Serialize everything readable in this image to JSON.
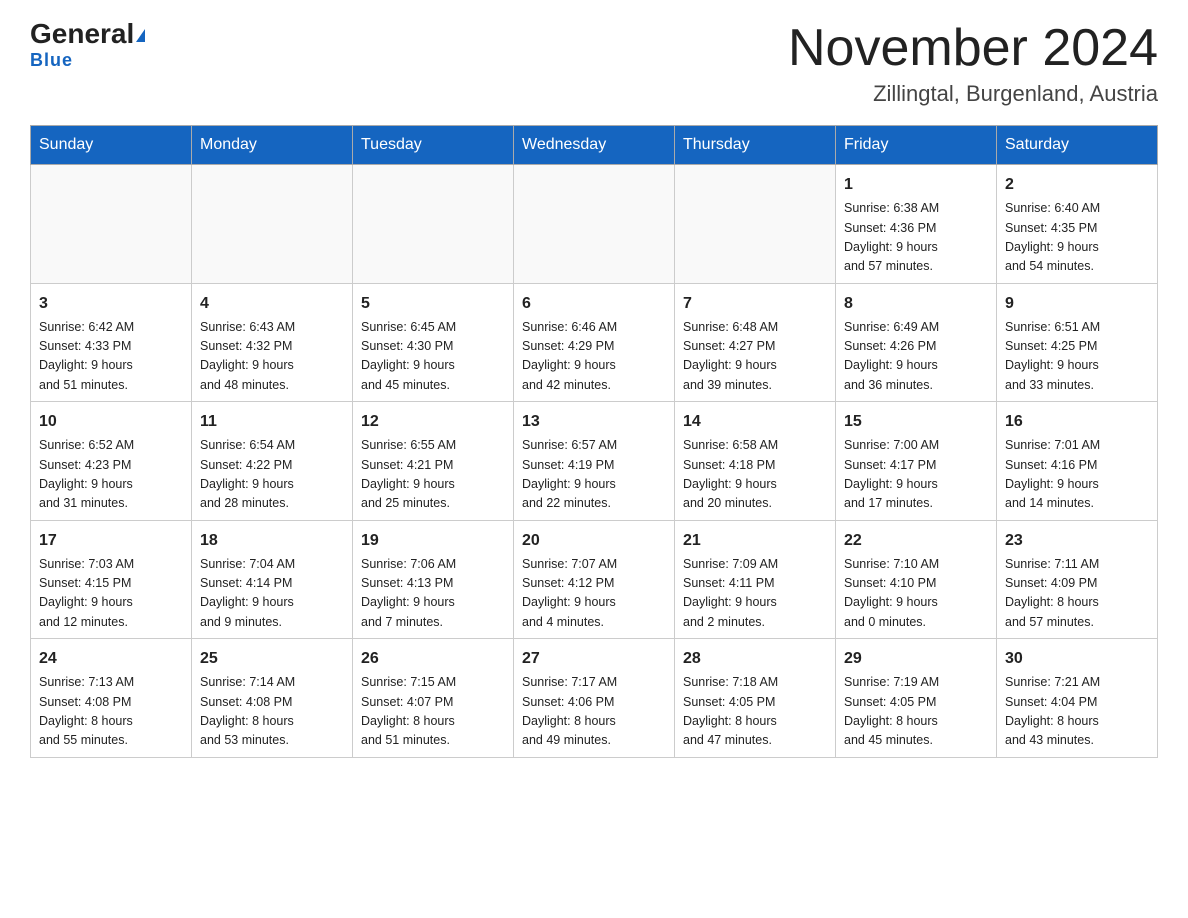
{
  "header": {
    "logo_text_black": "General",
    "logo_text_blue": "Blue",
    "month_title": "November 2024",
    "location": "Zillingtal, Burgenland, Austria"
  },
  "weekdays": [
    "Sunday",
    "Monday",
    "Tuesday",
    "Wednesday",
    "Thursday",
    "Friday",
    "Saturday"
  ],
  "weeks": [
    [
      {
        "day": "",
        "info": ""
      },
      {
        "day": "",
        "info": ""
      },
      {
        "day": "",
        "info": ""
      },
      {
        "day": "",
        "info": ""
      },
      {
        "day": "",
        "info": ""
      },
      {
        "day": "1",
        "info": "Sunrise: 6:38 AM\nSunset: 4:36 PM\nDaylight: 9 hours\nand 57 minutes."
      },
      {
        "day": "2",
        "info": "Sunrise: 6:40 AM\nSunset: 4:35 PM\nDaylight: 9 hours\nand 54 minutes."
      }
    ],
    [
      {
        "day": "3",
        "info": "Sunrise: 6:42 AM\nSunset: 4:33 PM\nDaylight: 9 hours\nand 51 minutes."
      },
      {
        "day": "4",
        "info": "Sunrise: 6:43 AM\nSunset: 4:32 PM\nDaylight: 9 hours\nand 48 minutes."
      },
      {
        "day": "5",
        "info": "Sunrise: 6:45 AM\nSunset: 4:30 PM\nDaylight: 9 hours\nand 45 minutes."
      },
      {
        "day": "6",
        "info": "Sunrise: 6:46 AM\nSunset: 4:29 PM\nDaylight: 9 hours\nand 42 minutes."
      },
      {
        "day": "7",
        "info": "Sunrise: 6:48 AM\nSunset: 4:27 PM\nDaylight: 9 hours\nand 39 minutes."
      },
      {
        "day": "8",
        "info": "Sunrise: 6:49 AM\nSunset: 4:26 PM\nDaylight: 9 hours\nand 36 minutes."
      },
      {
        "day": "9",
        "info": "Sunrise: 6:51 AM\nSunset: 4:25 PM\nDaylight: 9 hours\nand 33 minutes."
      }
    ],
    [
      {
        "day": "10",
        "info": "Sunrise: 6:52 AM\nSunset: 4:23 PM\nDaylight: 9 hours\nand 31 minutes."
      },
      {
        "day": "11",
        "info": "Sunrise: 6:54 AM\nSunset: 4:22 PM\nDaylight: 9 hours\nand 28 minutes."
      },
      {
        "day": "12",
        "info": "Sunrise: 6:55 AM\nSunset: 4:21 PM\nDaylight: 9 hours\nand 25 minutes."
      },
      {
        "day": "13",
        "info": "Sunrise: 6:57 AM\nSunset: 4:19 PM\nDaylight: 9 hours\nand 22 minutes."
      },
      {
        "day": "14",
        "info": "Sunrise: 6:58 AM\nSunset: 4:18 PM\nDaylight: 9 hours\nand 20 minutes."
      },
      {
        "day": "15",
        "info": "Sunrise: 7:00 AM\nSunset: 4:17 PM\nDaylight: 9 hours\nand 17 minutes."
      },
      {
        "day": "16",
        "info": "Sunrise: 7:01 AM\nSunset: 4:16 PM\nDaylight: 9 hours\nand 14 minutes."
      }
    ],
    [
      {
        "day": "17",
        "info": "Sunrise: 7:03 AM\nSunset: 4:15 PM\nDaylight: 9 hours\nand 12 minutes."
      },
      {
        "day": "18",
        "info": "Sunrise: 7:04 AM\nSunset: 4:14 PM\nDaylight: 9 hours\nand 9 minutes."
      },
      {
        "day": "19",
        "info": "Sunrise: 7:06 AM\nSunset: 4:13 PM\nDaylight: 9 hours\nand 7 minutes."
      },
      {
        "day": "20",
        "info": "Sunrise: 7:07 AM\nSunset: 4:12 PM\nDaylight: 9 hours\nand 4 minutes."
      },
      {
        "day": "21",
        "info": "Sunrise: 7:09 AM\nSunset: 4:11 PM\nDaylight: 9 hours\nand 2 minutes."
      },
      {
        "day": "22",
        "info": "Sunrise: 7:10 AM\nSunset: 4:10 PM\nDaylight: 9 hours\nand 0 minutes."
      },
      {
        "day": "23",
        "info": "Sunrise: 7:11 AM\nSunset: 4:09 PM\nDaylight: 8 hours\nand 57 minutes."
      }
    ],
    [
      {
        "day": "24",
        "info": "Sunrise: 7:13 AM\nSunset: 4:08 PM\nDaylight: 8 hours\nand 55 minutes."
      },
      {
        "day": "25",
        "info": "Sunrise: 7:14 AM\nSunset: 4:08 PM\nDaylight: 8 hours\nand 53 minutes."
      },
      {
        "day": "26",
        "info": "Sunrise: 7:15 AM\nSunset: 4:07 PM\nDaylight: 8 hours\nand 51 minutes."
      },
      {
        "day": "27",
        "info": "Sunrise: 7:17 AM\nSunset: 4:06 PM\nDaylight: 8 hours\nand 49 minutes."
      },
      {
        "day": "28",
        "info": "Sunrise: 7:18 AM\nSunset: 4:05 PM\nDaylight: 8 hours\nand 47 minutes."
      },
      {
        "day": "29",
        "info": "Sunrise: 7:19 AM\nSunset: 4:05 PM\nDaylight: 8 hours\nand 45 minutes."
      },
      {
        "day": "30",
        "info": "Sunrise: 7:21 AM\nSunset: 4:04 PM\nDaylight: 8 hours\nand 43 minutes."
      }
    ]
  ]
}
